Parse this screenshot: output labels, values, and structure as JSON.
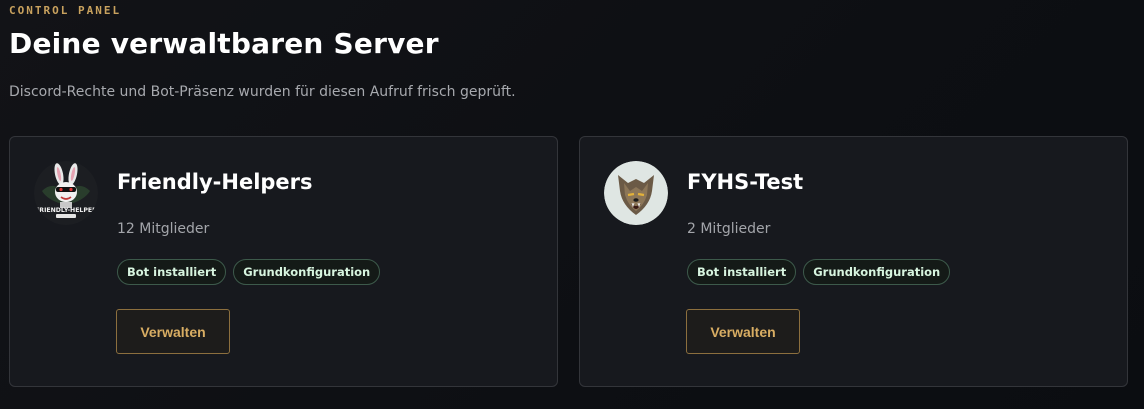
{
  "header": {
    "eyebrow": "CONTROL PANEL",
    "title": "Deine verwaltbaren Server",
    "subtitle": "Discord-Rechte und Bot-Präsenz wurden für diesen Aufruf frisch geprüft."
  },
  "servers": [
    {
      "name": "Friendly-Helpers",
      "members": "12 Mitglieder",
      "avatar_icon": "rabbit-logo-icon",
      "avatar_text": "FRIENDLY-HELPER",
      "badges": [
        "Bot installiert",
        "Grundkonfiguration"
      ],
      "button_label": "Verwalten"
    },
    {
      "name": "FYHS-Test",
      "members": "2 Mitglieder",
      "avatar_icon": "wolf-icon",
      "badges": [
        "Bot installiert",
        "Grundkonfiguration"
      ],
      "button_label": "Verwalten"
    }
  ],
  "colors": {
    "accent_gold": "#c9a25e",
    "button_text": "#d8ad63",
    "badge_border": "#3d5a4b",
    "card_bg": "#17191e"
  }
}
